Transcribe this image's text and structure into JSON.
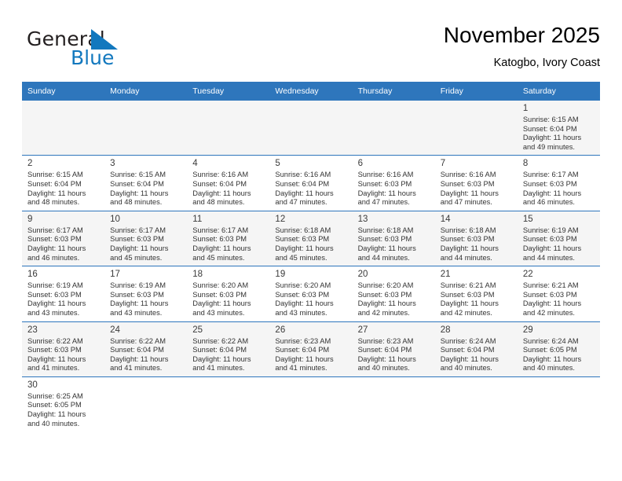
{
  "brand": {
    "name_part1": "General",
    "name_part2": "Blue",
    "flag_color": "#1278be",
    "text_color": "#231f20"
  },
  "header": {
    "title": "November 2025",
    "subtitle": "Katogbo, Ivory Coast"
  },
  "theme": {
    "header_bg": "#2e76bc",
    "header_text": "#ffffff",
    "row_shade": "#f5f5f5",
    "grid_line": "#2e76bc"
  },
  "calendar": {
    "weekday_headers": [
      "Sunday",
      "Monday",
      "Tuesday",
      "Wednesday",
      "Thursday",
      "Friday",
      "Saturday"
    ],
    "weeks": [
      [
        {
          "day": "",
          "info": ""
        },
        {
          "day": "",
          "info": ""
        },
        {
          "day": "",
          "info": ""
        },
        {
          "day": "",
          "info": ""
        },
        {
          "day": "",
          "info": ""
        },
        {
          "day": "",
          "info": ""
        },
        {
          "day": "1",
          "info": "Sunrise: 6:15 AM\nSunset: 6:04 PM\nDaylight: 11 hours\nand 49 minutes."
        }
      ],
      [
        {
          "day": "2",
          "info": "Sunrise: 6:15 AM\nSunset: 6:04 PM\nDaylight: 11 hours\nand 48 minutes."
        },
        {
          "day": "3",
          "info": "Sunrise: 6:15 AM\nSunset: 6:04 PM\nDaylight: 11 hours\nand 48 minutes."
        },
        {
          "day": "4",
          "info": "Sunrise: 6:16 AM\nSunset: 6:04 PM\nDaylight: 11 hours\nand 48 minutes."
        },
        {
          "day": "5",
          "info": "Sunrise: 6:16 AM\nSunset: 6:04 PM\nDaylight: 11 hours\nand 47 minutes."
        },
        {
          "day": "6",
          "info": "Sunrise: 6:16 AM\nSunset: 6:03 PM\nDaylight: 11 hours\nand 47 minutes."
        },
        {
          "day": "7",
          "info": "Sunrise: 6:16 AM\nSunset: 6:03 PM\nDaylight: 11 hours\nand 47 minutes."
        },
        {
          "day": "8",
          "info": "Sunrise: 6:17 AM\nSunset: 6:03 PM\nDaylight: 11 hours\nand 46 minutes."
        }
      ],
      [
        {
          "day": "9",
          "info": "Sunrise: 6:17 AM\nSunset: 6:03 PM\nDaylight: 11 hours\nand 46 minutes."
        },
        {
          "day": "10",
          "info": "Sunrise: 6:17 AM\nSunset: 6:03 PM\nDaylight: 11 hours\nand 45 minutes."
        },
        {
          "day": "11",
          "info": "Sunrise: 6:17 AM\nSunset: 6:03 PM\nDaylight: 11 hours\nand 45 minutes."
        },
        {
          "day": "12",
          "info": "Sunrise: 6:18 AM\nSunset: 6:03 PM\nDaylight: 11 hours\nand 45 minutes."
        },
        {
          "day": "13",
          "info": "Sunrise: 6:18 AM\nSunset: 6:03 PM\nDaylight: 11 hours\nand 44 minutes."
        },
        {
          "day": "14",
          "info": "Sunrise: 6:18 AM\nSunset: 6:03 PM\nDaylight: 11 hours\nand 44 minutes."
        },
        {
          "day": "15",
          "info": "Sunrise: 6:19 AM\nSunset: 6:03 PM\nDaylight: 11 hours\nand 44 minutes."
        }
      ],
      [
        {
          "day": "16",
          "info": "Sunrise: 6:19 AM\nSunset: 6:03 PM\nDaylight: 11 hours\nand 43 minutes."
        },
        {
          "day": "17",
          "info": "Sunrise: 6:19 AM\nSunset: 6:03 PM\nDaylight: 11 hours\nand 43 minutes."
        },
        {
          "day": "18",
          "info": "Sunrise: 6:20 AM\nSunset: 6:03 PM\nDaylight: 11 hours\nand 43 minutes."
        },
        {
          "day": "19",
          "info": "Sunrise: 6:20 AM\nSunset: 6:03 PM\nDaylight: 11 hours\nand 43 minutes."
        },
        {
          "day": "20",
          "info": "Sunrise: 6:20 AM\nSunset: 6:03 PM\nDaylight: 11 hours\nand 42 minutes."
        },
        {
          "day": "21",
          "info": "Sunrise: 6:21 AM\nSunset: 6:03 PM\nDaylight: 11 hours\nand 42 minutes."
        },
        {
          "day": "22",
          "info": "Sunrise: 6:21 AM\nSunset: 6:03 PM\nDaylight: 11 hours\nand 42 minutes."
        }
      ],
      [
        {
          "day": "23",
          "info": "Sunrise: 6:22 AM\nSunset: 6:03 PM\nDaylight: 11 hours\nand 41 minutes."
        },
        {
          "day": "24",
          "info": "Sunrise: 6:22 AM\nSunset: 6:04 PM\nDaylight: 11 hours\nand 41 minutes."
        },
        {
          "day": "25",
          "info": "Sunrise: 6:22 AM\nSunset: 6:04 PM\nDaylight: 11 hours\nand 41 minutes."
        },
        {
          "day": "26",
          "info": "Sunrise: 6:23 AM\nSunset: 6:04 PM\nDaylight: 11 hours\nand 41 minutes."
        },
        {
          "day": "27",
          "info": "Sunrise: 6:23 AM\nSunset: 6:04 PM\nDaylight: 11 hours\nand 40 minutes."
        },
        {
          "day": "28",
          "info": "Sunrise: 6:24 AM\nSunset: 6:04 PM\nDaylight: 11 hours\nand 40 minutes."
        },
        {
          "day": "29",
          "info": "Sunrise: 6:24 AM\nSunset: 6:05 PM\nDaylight: 11 hours\nand 40 minutes."
        }
      ],
      [
        {
          "day": "30",
          "info": "Sunrise: 6:25 AM\nSunset: 6:05 PM\nDaylight: 11 hours\nand 40 minutes."
        },
        {
          "day": "",
          "info": ""
        },
        {
          "day": "",
          "info": ""
        },
        {
          "day": "",
          "info": ""
        },
        {
          "day": "",
          "info": ""
        },
        {
          "day": "",
          "info": ""
        },
        {
          "day": "",
          "info": ""
        }
      ]
    ]
  }
}
